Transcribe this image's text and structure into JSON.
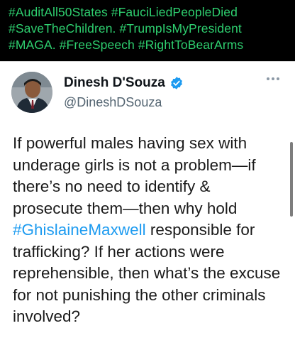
{
  "header": {
    "hashtag_lines": [
      "#AuditAll50States #FauciLiedPeopleDied",
      "#SaveTheChildren. #TrumpIsMyPresident",
      "#MAGA. #FreeSpeech #RightToBearArms"
    ]
  },
  "tweet": {
    "author_name": "Dinesh D'Souza",
    "author_handle": "@DineshDSouza",
    "text_before": "If powerful males having sex with underage girls is not a problem—if there’s no need to identify & prosecute them—then why hold ",
    "hashtag": "#GhislaineMaxwell",
    "text_after": " responsible for trafficking? If her actions were reprehensible, then what’s the excuse for not punishing the other criminals involved?"
  },
  "icons": {
    "verified": "verified-badge-icon",
    "more": "more-options-icon"
  },
  "colors": {
    "hashtag_green": "#2ecf6f",
    "link_blue": "#1d9bf0",
    "verified_blue": "#1d9bf0"
  }
}
